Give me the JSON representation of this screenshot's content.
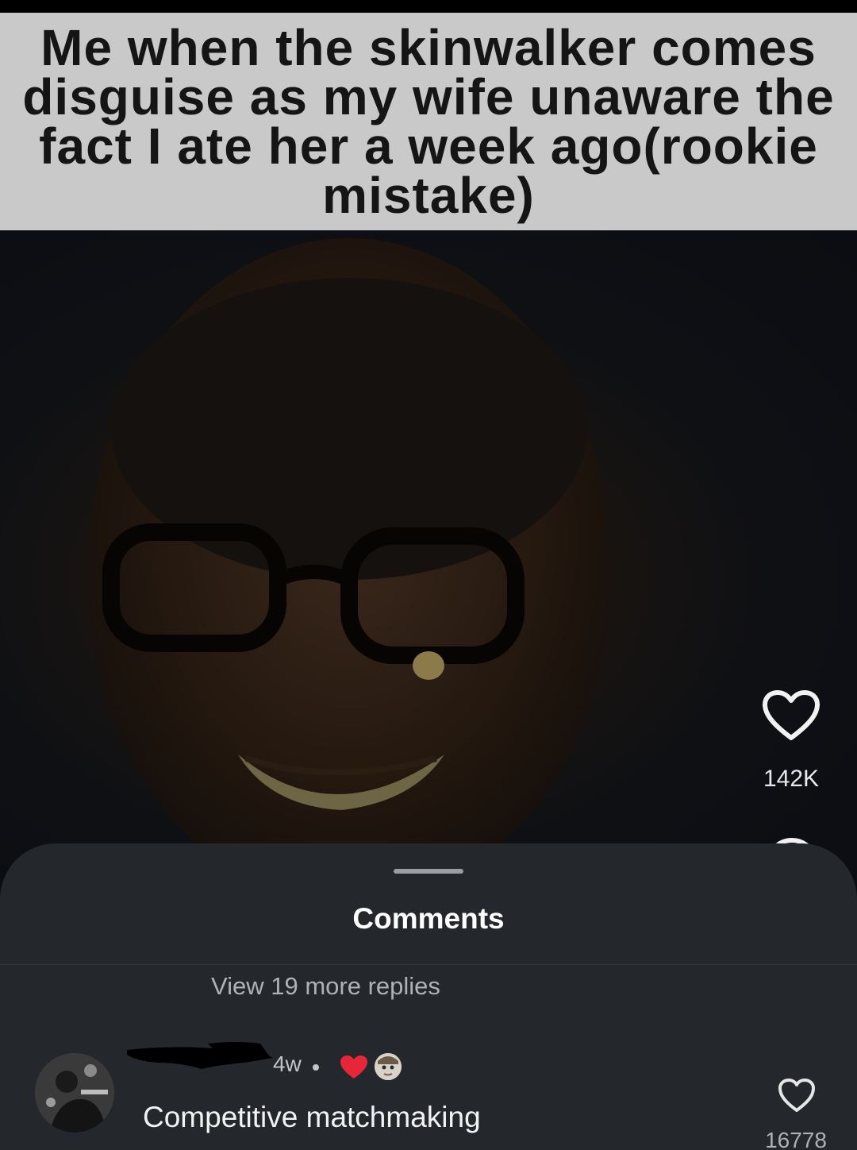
{
  "post": {
    "caption": "Me when the skinwalker comes disguise as my wife unaware the fact I ate her a week ago(rookie mistake)",
    "like_icon": "heart-outline-icon",
    "like_count": "142K",
    "comment_icon": "comment-bubble-icon"
  },
  "comments_sheet": {
    "title": "Comments",
    "view_more_replies": "View 19 more replies",
    "comments": [
      {
        "avatar_icon": "user-avatar",
        "username": "",
        "timestamp": "4w",
        "liked_by_creator_icon": "red-heart-icon",
        "creator_avatar_icon": "creator-avatar",
        "text": "Competitive matchmaking",
        "like_icon": "heart-outline-icon",
        "like_count": "16778"
      }
    ]
  },
  "colors": {
    "caption_background": "#c9c9c9",
    "caption_text": "#151515",
    "sheet_background": "#24272b",
    "liked_heart": "#e8263a",
    "secondary_text": "#aeb1b6"
  }
}
